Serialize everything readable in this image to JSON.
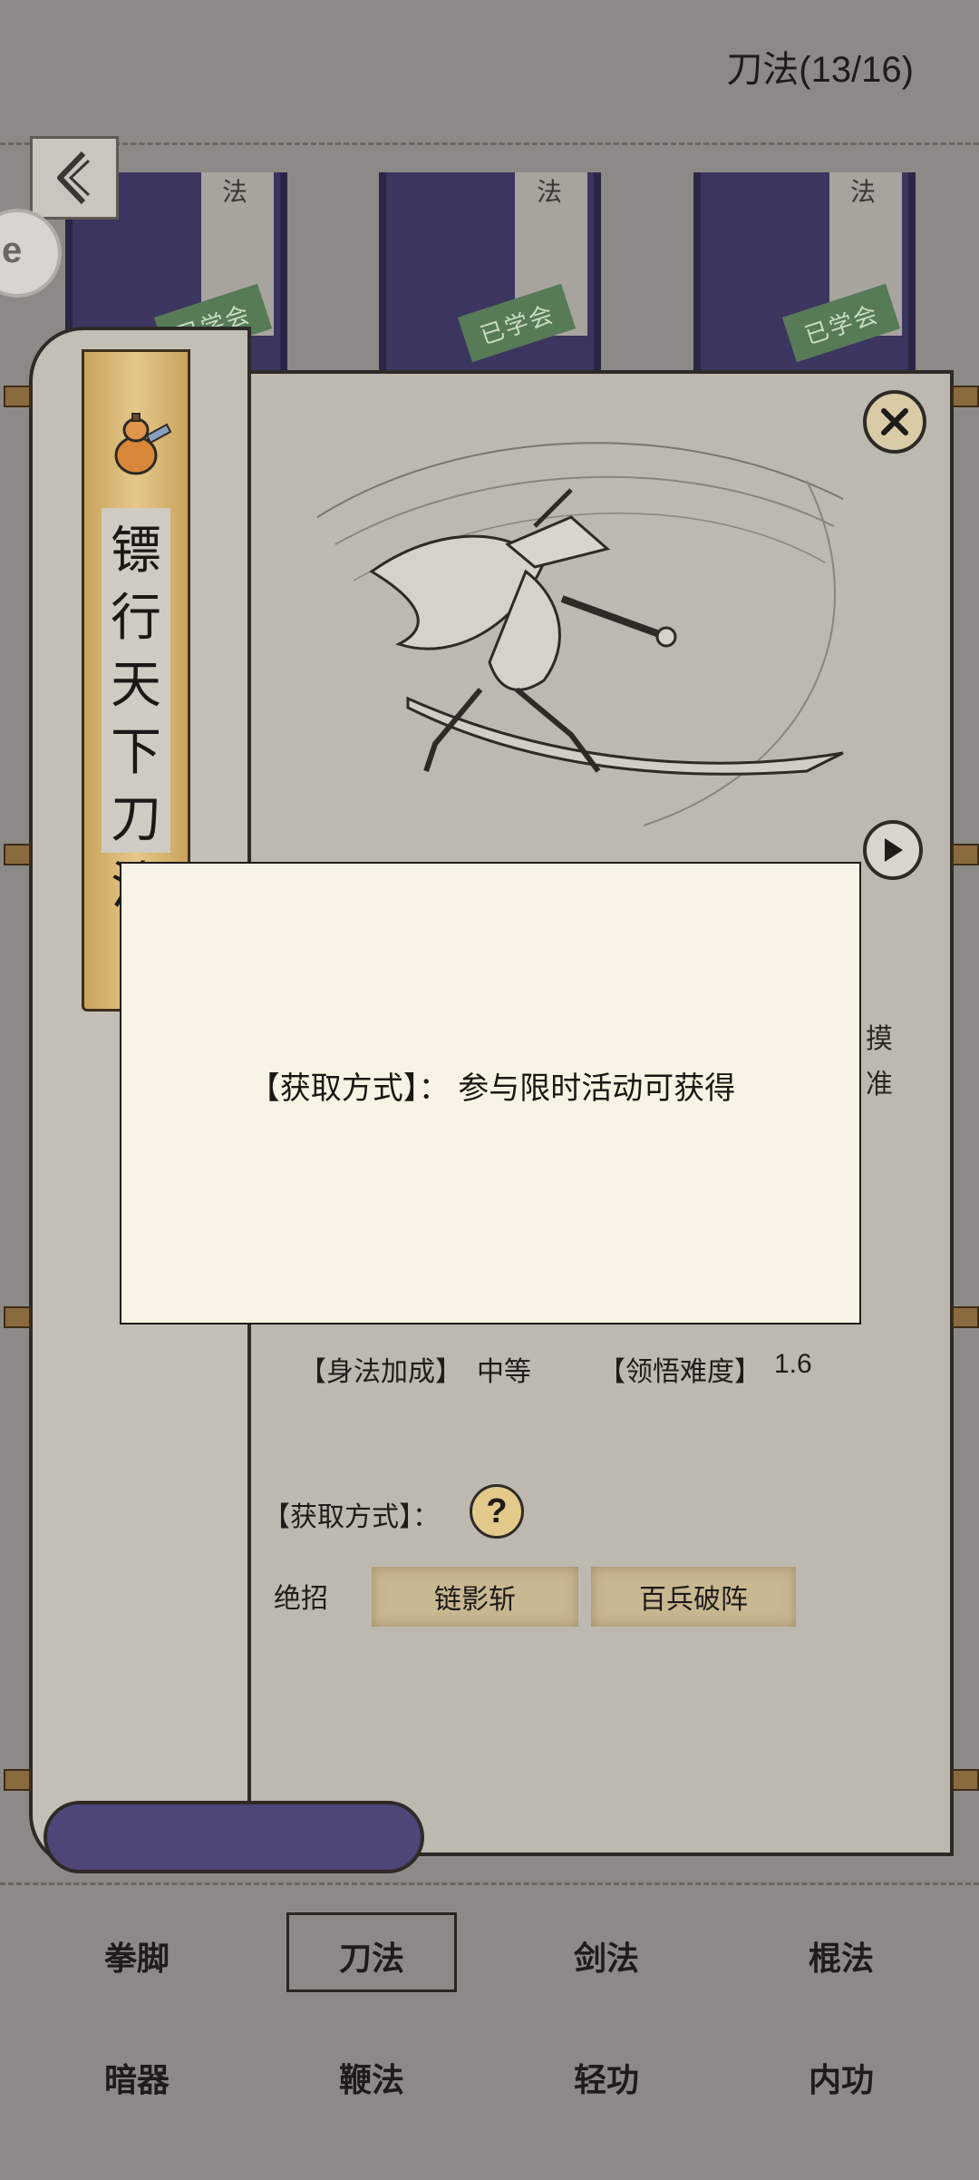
{
  "header": {
    "title": "刀法(13/16)"
  },
  "top_strips": [
    {
      "top_label": "法",
      "stamp": "已学会"
    },
    {
      "top_label": "法",
      "stamp": "已学会"
    },
    {
      "top_label": "法",
      "stamp": "已学会"
    }
  ],
  "left_badge": {
    "text": "e"
  },
  "skill": {
    "name_chars": [
      "镖",
      "行",
      "天",
      "下",
      "刀",
      "法"
    ],
    "right_glyphs": [
      "摸",
      "准"
    ]
  },
  "popup": {
    "text": "【获取方式】：  参与限时活动可获得"
  },
  "stats": {
    "agility_label": "【身法加成】",
    "agility_value": "中等",
    "difficulty_label": "【领悟难度】",
    "difficulty_value": "1.6",
    "source_label": "【获取方式】：",
    "help_symbol": "?",
    "ultimate_label": "绝招",
    "ultimates": [
      "链影斩",
      "百兵破阵"
    ]
  },
  "tabs": {
    "row1": [
      "拳脚",
      "刀法",
      "剑法",
      "棍法"
    ],
    "row2": [
      "暗器",
      "鞭法",
      "轻功",
      "内功"
    ],
    "active": "刀法"
  },
  "colors": {
    "background": "#8c8a86",
    "scroll_paper": "#bdb9b0",
    "banner_gold": "#e5c889",
    "strip_purple": "#3c3560",
    "stamp_green": "#577a57",
    "popup_bg": "#f8f3e4"
  },
  "icons": [
    "back-chevron-icon",
    "gourd-icon",
    "close-sword-icon",
    "play-icon",
    "help-icon"
  ]
}
